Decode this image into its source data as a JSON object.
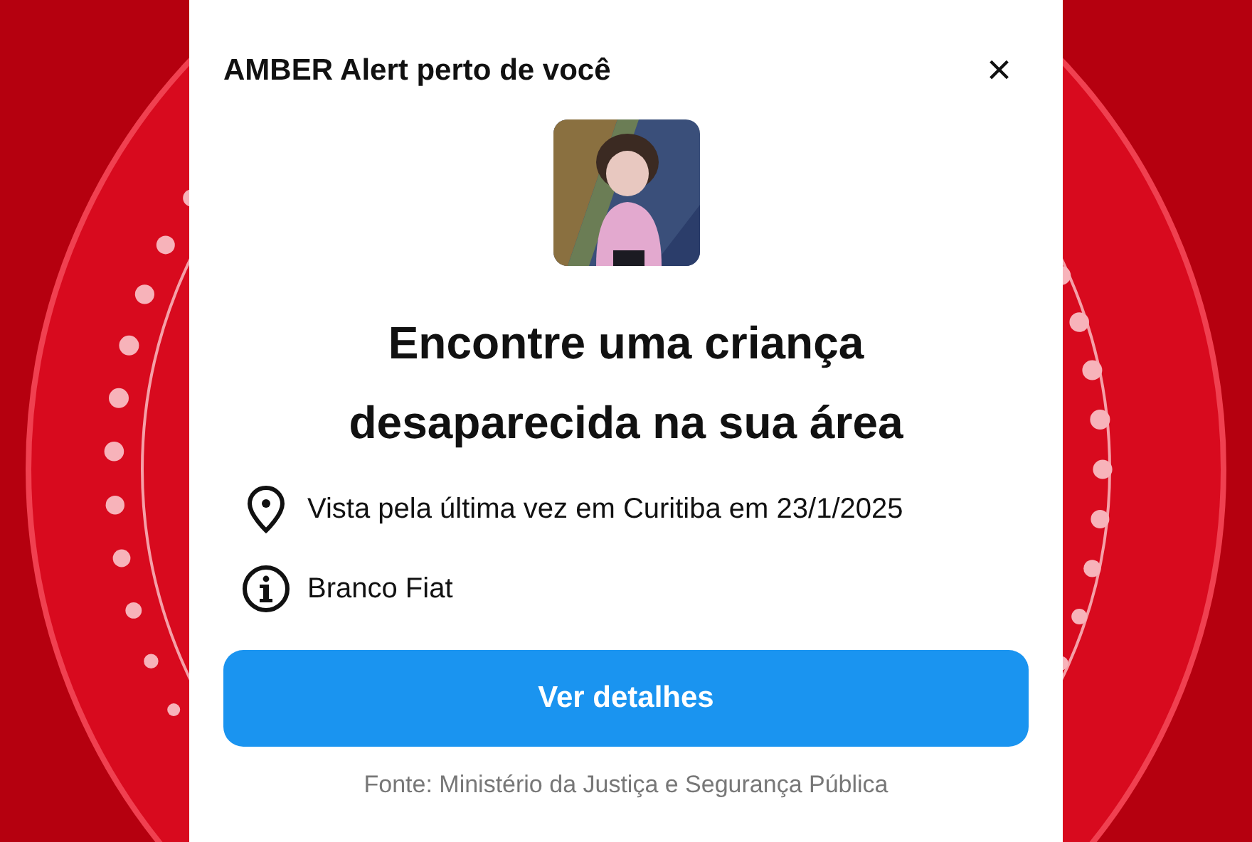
{
  "alert": {
    "title": "AMBER Alert perto de você",
    "close": "×",
    "headline": "Encontre uma criança desaparecida na sua área",
    "details": [
      {
        "kind": "location",
        "text": "Vista pela última vez em Curitiba em 23/1/2025"
      },
      {
        "kind": "info",
        "text": "Branco Fiat"
      }
    ],
    "button": "Ver detalhes",
    "source": "Fonte: Ministério da Justiça e Segurança Pública"
  }
}
